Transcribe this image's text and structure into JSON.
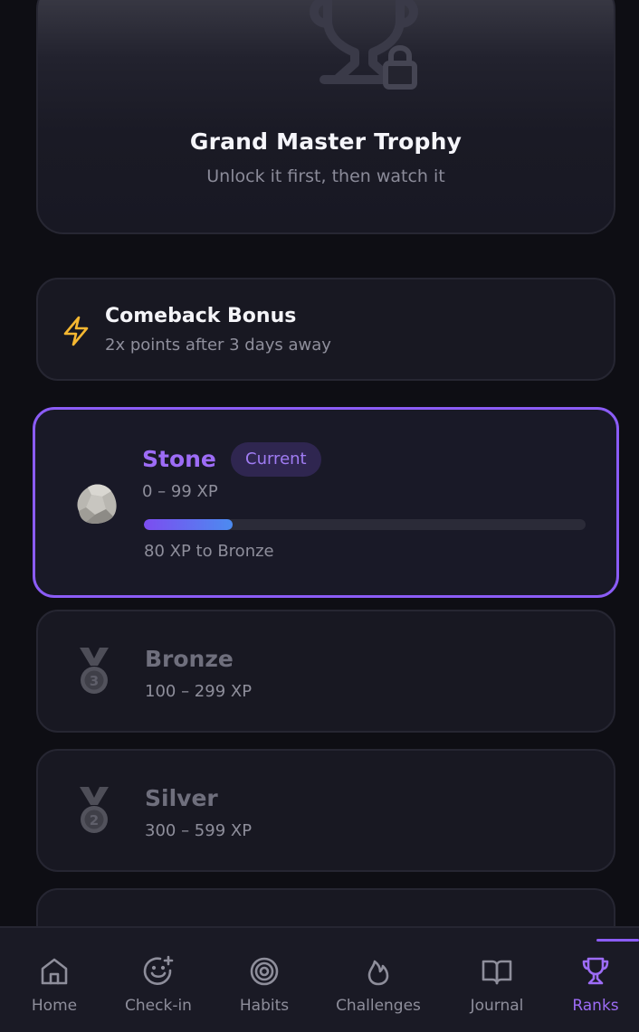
{
  "trophy": {
    "title": "Grand Master Trophy",
    "subtitle": "Unlock it first, then watch it",
    "icon": "trophy-locked-icon"
  },
  "bonus": {
    "title": "Comeback Bonus",
    "subtitle": "2x points after 3 days away",
    "icon": "lightning-icon",
    "icon_color": "#f5b731"
  },
  "ranks": [
    {
      "name": "Stone",
      "range": "0 – 99 XP",
      "badge": "Current",
      "progress_fraction": 0.2,
      "progress_label": "80 XP to Bronze",
      "icon": "stone-icon"
    },
    {
      "name": "Bronze",
      "range": "100 – 299 XP",
      "icon": "medal-3-icon"
    },
    {
      "name": "Silver",
      "range": "300 – 599 XP",
      "icon": "medal-2-icon"
    }
  ],
  "nav": {
    "active": "Ranks",
    "accent": "#8b5cf6",
    "items": [
      {
        "label": "Home",
        "icon": "home-icon"
      },
      {
        "label": "Check-in",
        "icon": "smile-plus-icon"
      },
      {
        "label": "Habits",
        "icon": "target-icon"
      },
      {
        "label": "Challenges",
        "icon": "flame-icon"
      },
      {
        "label": "Journal",
        "icon": "book-icon"
      },
      {
        "label": "Ranks",
        "icon": "trophy-icon"
      }
    ]
  }
}
